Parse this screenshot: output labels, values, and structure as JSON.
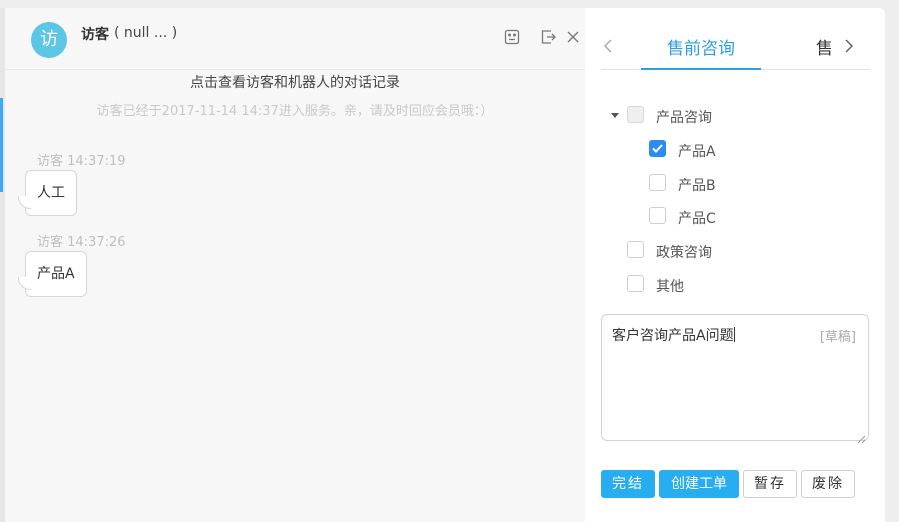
{
  "header": {
    "avatar_char": "访",
    "visitor_name": "访客",
    "visitor_info": "( null ... )"
  },
  "chat": {
    "record_link": "点击查看访客和机器人的对话记录",
    "entered_note": "访客已经于2017-11-14 14:37进入服务。亲，请及时回应会员哦：）",
    "messages": [
      {
        "time": "访客 14:37:19",
        "text": "人工"
      },
      {
        "time": "访客 14:37:26",
        "text": "产品A"
      }
    ]
  },
  "side": {
    "tab_active": "售前咨询",
    "tab_next": "售",
    "tree": [
      {
        "label": "产品咨询",
        "level": 0,
        "expanded": true,
        "checked": false,
        "disabled": true
      },
      {
        "label": "产品A",
        "level": 1,
        "checked": true
      },
      {
        "label": "产品B",
        "level": 1,
        "checked": false
      },
      {
        "label": "产品C",
        "level": 1,
        "checked": false
      },
      {
        "label": "政策咨询",
        "level": 0,
        "checked": false
      },
      {
        "label": "其他",
        "level": 0,
        "checked": false
      }
    ],
    "note_text": "客户咨询产品A问题",
    "draft_label": "[草稿]",
    "buttons": {
      "finish": "完结",
      "create_ticket": "创建工单",
      "save_temp": "暂存",
      "discard": "废除"
    }
  },
  "colors": {
    "accent": "#2aa0e0",
    "button_primary": "#28aef0",
    "checkbox_checked": "#2d8cf0",
    "avatar": "#5bc6e6"
  }
}
